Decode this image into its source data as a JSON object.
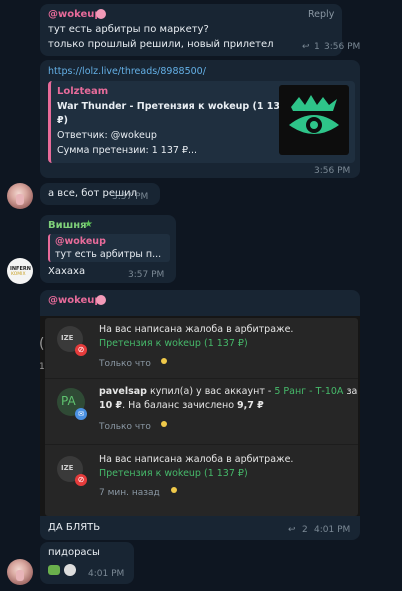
{
  "msg1": {
    "author": "@wokeup",
    "reply_label": "Reply",
    "line1": "тут есть арбитры по маркету?",
    "line2": "только прошлый решили, новый прилетел",
    "reply_count": "1",
    "time": "3:56 PM"
  },
  "msg2": {
    "url": "https://lolz.live/threads/8988500/",
    "preview_site": "Lolzteam",
    "preview_title_line1": "War Thunder - Претензия к wokeup (1 137",
    "preview_title_line2": "₽)",
    "preview_line3": "Ответчик: @wokeup",
    "preview_line4": "Сумма претензии: 1 137 ₽...",
    "time": "3:56 PM"
  },
  "msg3": {
    "text": "а все, бот решил",
    "time": "3:57 PM"
  },
  "msg4": {
    "author": "Вишня",
    "quote_author": "@wokeup",
    "quote_text": "тут есть арбитры п...",
    "text": "Хахаха",
    "time": "3:57 PM",
    "avatar_top": "INFERN",
    "avatar_bottom": "KOMIX"
  },
  "msg5": {
    "author": "@wokeup",
    "notifications": [
      {
        "avatar": "IZE",
        "title": "На вас написана жалоба в арбитраже.",
        "subtitle": "Претензия к wokeup (1 137 ₽)",
        "time": "Только что"
      },
      {
        "avatar": "PA",
        "user": "pavelsap",
        "part1": " купил(а) у вас аккаунт - ",
        "green": "5 Ранг - Т-10А",
        "part2": " за",
        "line2_a": "10 ₽",
        "line2_b": ". На баланс зачислено ",
        "line2_c": "9,7 ₽",
        "time": "Только что"
      },
      {
        "avatar": "IZE",
        "title": "На вас написана жалоба в арбитраже.",
        "subtitle": "Претензия к wokeup (1 137 ₽)",
        "time": "7 мин. назад"
      }
    ],
    "text": "ДА БЛЯТЬ",
    "reply_count": "2",
    "time": "4:01 PM"
  },
  "msg6": {
    "text": "пидорасы",
    "time": "4:01 PM"
  },
  "colors": {
    "background": "#0e1621",
    "bubble": "#182533",
    "author_pink": "#e76b9a",
    "author_green": "#7fd07a",
    "link": "#64b0e6",
    "notif_green": "#46b96a"
  }
}
